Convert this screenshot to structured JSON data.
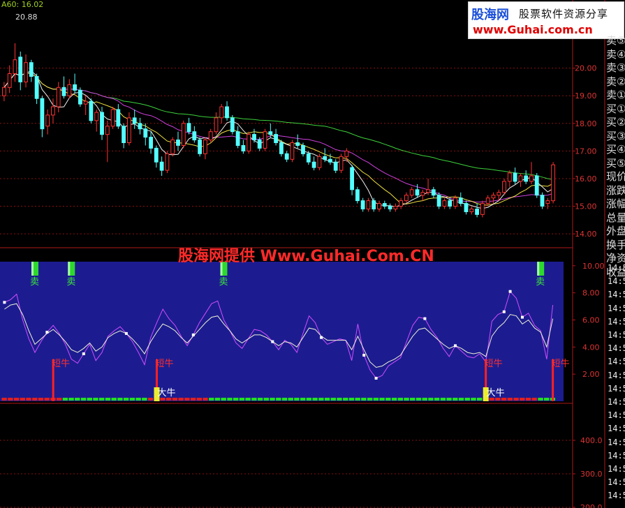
{
  "header": {
    "ma_label": "A60: 16.02",
    "max_price": "20.88"
  },
  "watermark": "股海网提供 Www.Guhai.Com.CN",
  "logo": {
    "brand": "股海网",
    "slogan": "股票软件资源分享",
    "url": "www.Guhai.com.cn"
  },
  "side_labels": [
    "卖⑤",
    "卖④",
    "卖③",
    "卖②",
    "卖①",
    "买①",
    "买②",
    "买③",
    "买④",
    "买⑤",
    "现价",
    "涨跌",
    "涨幅",
    "总量",
    "外盘",
    "换手",
    "净资",
    "收益"
  ],
  "time_labels": [
    "14:5",
    "14:5",
    "14:5",
    "14:5",
    "14:5",
    "14:5",
    "14:5",
    "14:5",
    "14:5",
    "14:5",
    "14:5",
    "14:5",
    "14:5",
    "14:5",
    "14:5",
    "14:5",
    "14:5",
    "14:5"
  ],
  "chart_data": [
    {
      "type": "candlestick",
      "ylim": [
        13.7,
        20.9
      ],
      "yticks": [
        "20.00",
        "19.00",
        "18.00",
        "17.00",
        "16.00",
        "15.00",
        "14.00"
      ],
      "ytick_values": [
        20,
        19,
        18,
        17,
        16,
        15,
        14
      ],
      "candles": [
        [
          19.0,
          19.5,
          18.8,
          19.3
        ],
        [
          19.3,
          20.1,
          19.1,
          19.8
        ],
        [
          19.8,
          20.9,
          19.5,
          20.3
        ],
        [
          20.4,
          20.6,
          19.2,
          19.5
        ],
        [
          19.5,
          20.5,
          19.3,
          20.2
        ],
        [
          20.2,
          20.3,
          19.5,
          19.7
        ],
        [
          19.7,
          19.8,
          18.7,
          18.9
        ],
        [
          18.9,
          19.0,
          17.5,
          17.8
        ],
        [
          17.9,
          18.5,
          17.6,
          18.3
        ],
        [
          18.3,
          18.9,
          18.0,
          18.6
        ],
        [
          18.6,
          19.5,
          18.4,
          19.3
        ],
        [
          19.3,
          19.7,
          18.9,
          19.0
        ],
        [
          19.0,
          19.6,
          18.9,
          19.4
        ],
        [
          19.4,
          19.8,
          19.1,
          19.2
        ],
        [
          19.2,
          19.3,
          18.6,
          18.7
        ],
        [
          18.7,
          19.0,
          18.3,
          18.8
        ],
        [
          18.8,
          18.9,
          18.0,
          18.1
        ],
        [
          18.1,
          18.5,
          17.7,
          18.4
        ],
        [
          18.4,
          18.6,
          17.4,
          17.6
        ],
        [
          17.6,
          18.1,
          16.6,
          17.9
        ],
        [
          17.9,
          18.6,
          17.8,
          18.5
        ],
        [
          18.5,
          18.7,
          17.8,
          17.9
        ],
        [
          17.9,
          18.0,
          17.1,
          17.3
        ],
        [
          17.3,
          18.4,
          17.2,
          18.2
        ],
        [
          18.2,
          18.5,
          17.8,
          18.0
        ],
        [
          18.0,
          18.2,
          17.6,
          17.8
        ],
        [
          17.8,
          18.0,
          17.2,
          17.5
        ],
        [
          17.5,
          17.7,
          16.9,
          17.1
        ],
        [
          17.1,
          17.2,
          16.4,
          16.6
        ],
        [
          16.6,
          16.8,
          16.1,
          16.3
        ],
        [
          16.3,
          17.0,
          16.2,
          16.9
        ],
        [
          16.9,
          17.5,
          16.8,
          17.4
        ],
        [
          17.4,
          17.7,
          17.0,
          17.2
        ],
        [
          17.2,
          18.1,
          17.1,
          18.0
        ],
        [
          18.0,
          18.2,
          17.6,
          17.7
        ],
        [
          17.7,
          17.9,
          17.3,
          17.4
        ],
        [
          17.4,
          17.5,
          16.8,
          16.9
        ],
        [
          16.9,
          17.5,
          16.7,
          17.4
        ],
        [
          17.4,
          17.8,
          17.3,
          17.7
        ],
        [
          17.7,
          18.4,
          17.6,
          18.2
        ],
        [
          18.2,
          18.7,
          18.0,
          18.6
        ],
        [
          18.6,
          18.8,
          18.1,
          18.2
        ],
        [
          18.2,
          18.3,
          17.6,
          17.7
        ],
        [
          17.7,
          17.9,
          17.1,
          17.2
        ],
        [
          17.2,
          17.4,
          16.9,
          17.0
        ],
        [
          17.0,
          17.7,
          16.9,
          17.6
        ],
        [
          17.6,
          17.8,
          17.3,
          17.4
        ],
        [
          17.4,
          17.5,
          17.0,
          17.1
        ],
        [
          17.1,
          17.8,
          17.0,
          17.7
        ],
        [
          17.7,
          18.0,
          17.5,
          17.6
        ],
        [
          17.6,
          17.8,
          17.2,
          17.3
        ],
        [
          17.3,
          17.4,
          16.8,
          16.9
        ],
        [
          16.9,
          17.0,
          16.6,
          16.7
        ],
        [
          16.7,
          17.4,
          16.6,
          17.3
        ],
        [
          17.3,
          17.6,
          17.1,
          17.2
        ],
        [
          17.2,
          17.3,
          16.8,
          16.9
        ],
        [
          16.9,
          17.0,
          16.5,
          16.6
        ],
        [
          16.6,
          16.8,
          16.3,
          16.4
        ],
        [
          16.4,
          16.9,
          16.3,
          16.8
        ],
        [
          16.8,
          17.1,
          16.6,
          16.7
        ],
        [
          16.7,
          16.9,
          16.5,
          16.6
        ],
        [
          16.6,
          16.7,
          16.2,
          16.3
        ],
        [
          16.3,
          16.9,
          16.2,
          16.8
        ],
        [
          16.8,
          17.1,
          16.6,
          17.0
        ],
        [
          16.4,
          16.5,
          15.4,
          15.6
        ],
        [
          15.6,
          15.7,
          15.1,
          15.2
        ],
        [
          15.2,
          15.3,
          14.8,
          14.9
        ],
        [
          14.9,
          15.3,
          14.8,
          15.2
        ],
        [
          15.2,
          15.3,
          14.8,
          14.9
        ],
        [
          14.9,
          15.2,
          14.8,
          15.1
        ],
        [
          15.1,
          15.2,
          14.9,
          15.0
        ],
        [
          15.0,
          15.1,
          14.8,
          14.9
        ],
        [
          14.9,
          15.1,
          14.8,
          15.0
        ],
        [
          15.0,
          15.3,
          14.9,
          15.2
        ],
        [
          15.2,
          15.5,
          15.1,
          15.4
        ],
        [
          15.4,
          15.7,
          15.3,
          15.6
        ],
        [
          15.6,
          15.8,
          15.3,
          15.4
        ],
        [
          15.4,
          15.6,
          15.2,
          15.5
        ],
        [
          15.5,
          16.0,
          15.4,
          15.6
        ],
        [
          15.6,
          15.7,
          15.3,
          15.4
        ],
        [
          15.4,
          15.5,
          14.9,
          15.0
        ],
        [
          15.0,
          15.3,
          14.9,
          15.2
        ],
        [
          15.2,
          15.3,
          14.9,
          15.0
        ],
        [
          15.0,
          15.4,
          14.9,
          15.3
        ],
        [
          15.3,
          15.5,
          15.0,
          15.1
        ],
        [
          15.1,
          15.2,
          14.7,
          14.8
        ],
        [
          14.8,
          15.0,
          14.7,
          14.9
        ],
        [
          14.9,
          15.1,
          14.6,
          14.7
        ],
        [
          14.7,
          15.2,
          14.6,
          15.1
        ],
        [
          15.1,
          15.4,
          15.0,
          15.3
        ],
        [
          15.3,
          15.5,
          15.1,
          15.4
        ],
        [
          15.4,
          15.6,
          15.2,
          15.5
        ],
        [
          15.5,
          16.0,
          15.4,
          15.9
        ],
        [
          15.9,
          16.3,
          15.7,
          16.2
        ],
        [
          16.2,
          16.4,
          15.8,
          15.9
        ],
        [
          15.9,
          16.2,
          15.7,
          16.1
        ],
        [
          16.1,
          16.3,
          15.8,
          15.9
        ],
        [
          15.9,
          16.6,
          15.8,
          16.1
        ],
        [
          16.1,
          16.2,
          15.3,
          15.4
        ],
        [
          15.4,
          15.5,
          14.9,
          15.0
        ],
        [
          15.1,
          15.3,
          14.9,
          15.2
        ],
        [
          15.2,
          16.6,
          15.1,
          16.5
        ]
      ]
    },
    {
      "type": "line",
      "ylim": [
        0,
        10.3
      ],
      "yticks": [
        "10.00",
        "8.00",
        "6.00",
        "4.00",
        "2.00"
      ],
      "ytick_values": [
        10,
        8,
        6,
        4,
        2
      ],
      "series": [
        {
          "name": "",
          "color": "#d24cff",
          "values": [
            7.3,
            7.5,
            7.9,
            6.0,
            4.6,
            3.6,
            4.4,
            5.1,
            5.6,
            5.0,
            4.2,
            3.1,
            2.8,
            3.5,
            4.2,
            3.0,
            3.6,
            4.8,
            5.2,
            5.5,
            5.0,
            4.4,
            3.6,
            2.7,
            4.7,
            5.8,
            6.8,
            6.1,
            5.6,
            4.8,
            4.1,
            4.9,
            5.8,
            6.5,
            7.2,
            7.4,
            6.0,
            5.2,
            4.3,
            3.9,
            4.6,
            5.3,
            5.2,
            4.9,
            4.4,
            3.8,
            4.5,
            4.2,
            3.6,
            5.0,
            6.3,
            5.8,
            4.7,
            4.2,
            4.4,
            4.6,
            4.5,
            3.0,
            5.7,
            3.4,
            2.3,
            1.7,
            1.9,
            2.6,
            2.9,
            3.2,
            4.4,
            5.6,
            6.2,
            6.1,
            5.3,
            4.7,
            3.9,
            3.3,
            4.1,
            3.7,
            3.3,
            3.2,
            3.5,
            2.9,
            5.9,
            6.4,
            6.6,
            8.1,
            7.6,
            6.2,
            6.5,
            5.6,
            5.2,
            3.1,
            7.1
          ]
        },
        {
          "name": "",
          "color": "#f0f0d8",
          "values": [
            6.8,
            7.1,
            7.2,
            6.4,
            5.2,
            4.2,
            4.6,
            5.0,
            5.3,
            4.9,
            4.4,
            3.8,
            3.6,
            3.9,
            4.3,
            3.7,
            4.0,
            4.7,
            5.0,
            5.2,
            5.0,
            4.6,
            4.1,
            3.5,
            4.4,
            5.1,
            5.7,
            5.5,
            5.2,
            4.7,
            4.3,
            4.8,
            5.3,
            5.8,
            6.2,
            6.3,
            5.7,
            5.2,
            4.6,
            4.3,
            4.6,
            4.9,
            4.9,
            4.7,
            4.4,
            4.1,
            4.4,
            4.3,
            4.0,
            4.7,
            5.4,
            5.3,
            4.8,
            4.5,
            4.5,
            4.5,
            4.5,
            3.8,
            4.8,
            3.8,
            2.9,
            2.5,
            2.6,
            2.9,
            3.1,
            3.4,
            4.1,
            4.8,
            5.3,
            5.4,
            5.0,
            4.6,
            4.2,
            3.9,
            4.1,
            3.9,
            3.6,
            3.5,
            3.6,
            3.3,
            4.8,
            5.4,
            5.8,
            6.4,
            6.3,
            5.7,
            6.0,
            5.4,
            5.1,
            4.0,
            6.1
          ]
        }
      ],
      "markers": [
        {
          "label": "卖",
          "index": 5
        },
        {
          "label": "卖",
          "index": 11
        },
        {
          "label": "卖",
          "index": 36
        },
        {
          "label": "卖",
          "index": 88
        },
        {
          "label": "短牛",
          "index": 8
        },
        {
          "label": "短牛",
          "index": 25
        },
        {
          "label": "短牛",
          "index": 79
        },
        {
          "label": "短牛",
          "index": 90
        },
        {
          "label": "大牛",
          "index": 25
        },
        {
          "label": "大牛",
          "index": 79
        }
      ]
    },
    {
      "type": "bar",
      "ylim": [
        0,
        500
      ],
      "yticks": [
        "400.0",
        "300.0",
        "200.0"
      ],
      "ytick_values": [
        400,
        300,
        200
      ]
    }
  ]
}
